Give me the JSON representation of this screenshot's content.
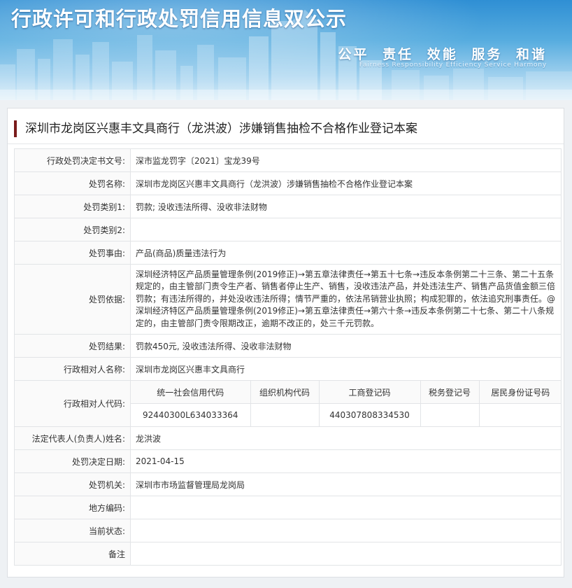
{
  "header": {
    "title": "行政许可和行政处罚信用信息双公示",
    "slogan": "公平 责任 效能 服务 和谐",
    "slogan_en": "Fairness Responsibility Efficiency Service Harmony"
  },
  "case_title": "深圳市龙岗区兴惠丰文具商行（龙洪波）涉嫌销售抽检不合格作业登记本案",
  "rows": {
    "decision_no": {
      "label": "行政处罚决定书文号:",
      "value": "深市监龙罚字〔2021〕宝龙39号"
    },
    "name": {
      "label": "处罚名称:",
      "value": "深圳市龙岗区兴惠丰文具商行（龙洪波）涉嫌销售抽检不合格作业登记本案"
    },
    "category1": {
      "label": "处罚类别1:",
      "value": "罚款; 没收违法所得、没收非法财物"
    },
    "category2": {
      "label": "处罚类别2:",
      "value": ""
    },
    "reason": {
      "label": "处罚事由:",
      "value": "产品(商品)质量违法行为"
    },
    "basis": {
      "label": "处罚依据:",
      "value": "深圳经济特区产品质量管理条例(2019修正)→第五章法律责任→第五十七条→违反本条例第二十三条、第二十五条规定的，由主管部门责令生产者、销售者停止生产、销售，没收违法产品，并处违法生产、销售产品货值金额三倍罚款；有违法所得的，并处没收违法所得；情节严重的，依法吊销营业执照；构成犯罪的，依法追究刑事责任。@深圳经济特区产品质量管理条例(2019修正)→第五章法律责任→第六十条→违反本条例第二十七条、第二十八条规定的，由主管部门责令限期改正，逾期不改正的，处三千元罚款。"
    },
    "result": {
      "label": "处罚结果:",
      "value": "罚款450元, 没收违法所得、没收非法财物"
    },
    "party_name": {
      "label": "行政相对人名称:",
      "value": "深圳市龙岗区兴惠丰文具商行"
    },
    "party_code": {
      "label": "行政相对人代码:"
    },
    "legal_rep": {
      "label": "法定代表人(负责人)姓名:",
      "value": "龙洪波"
    },
    "decision_date": {
      "label": "处罚决定日期:",
      "value": "2021-04-15"
    },
    "authority": {
      "label": "处罚机关:",
      "value": "深圳市市场监督管理局龙岗局"
    },
    "region_code": {
      "label": "地方编码:",
      "value": ""
    },
    "status": {
      "label": "当前状态:",
      "value": ""
    },
    "remark": {
      "label": "备注",
      "value": ""
    }
  },
  "codes": {
    "headers": [
      "统一社会信用代码",
      "组织机构代码",
      "工商登记码",
      "税务登记号",
      "居民身份证号码"
    ],
    "values": [
      "92440300L634033364",
      "",
      "440307808334530",
      "",
      ""
    ]
  }
}
